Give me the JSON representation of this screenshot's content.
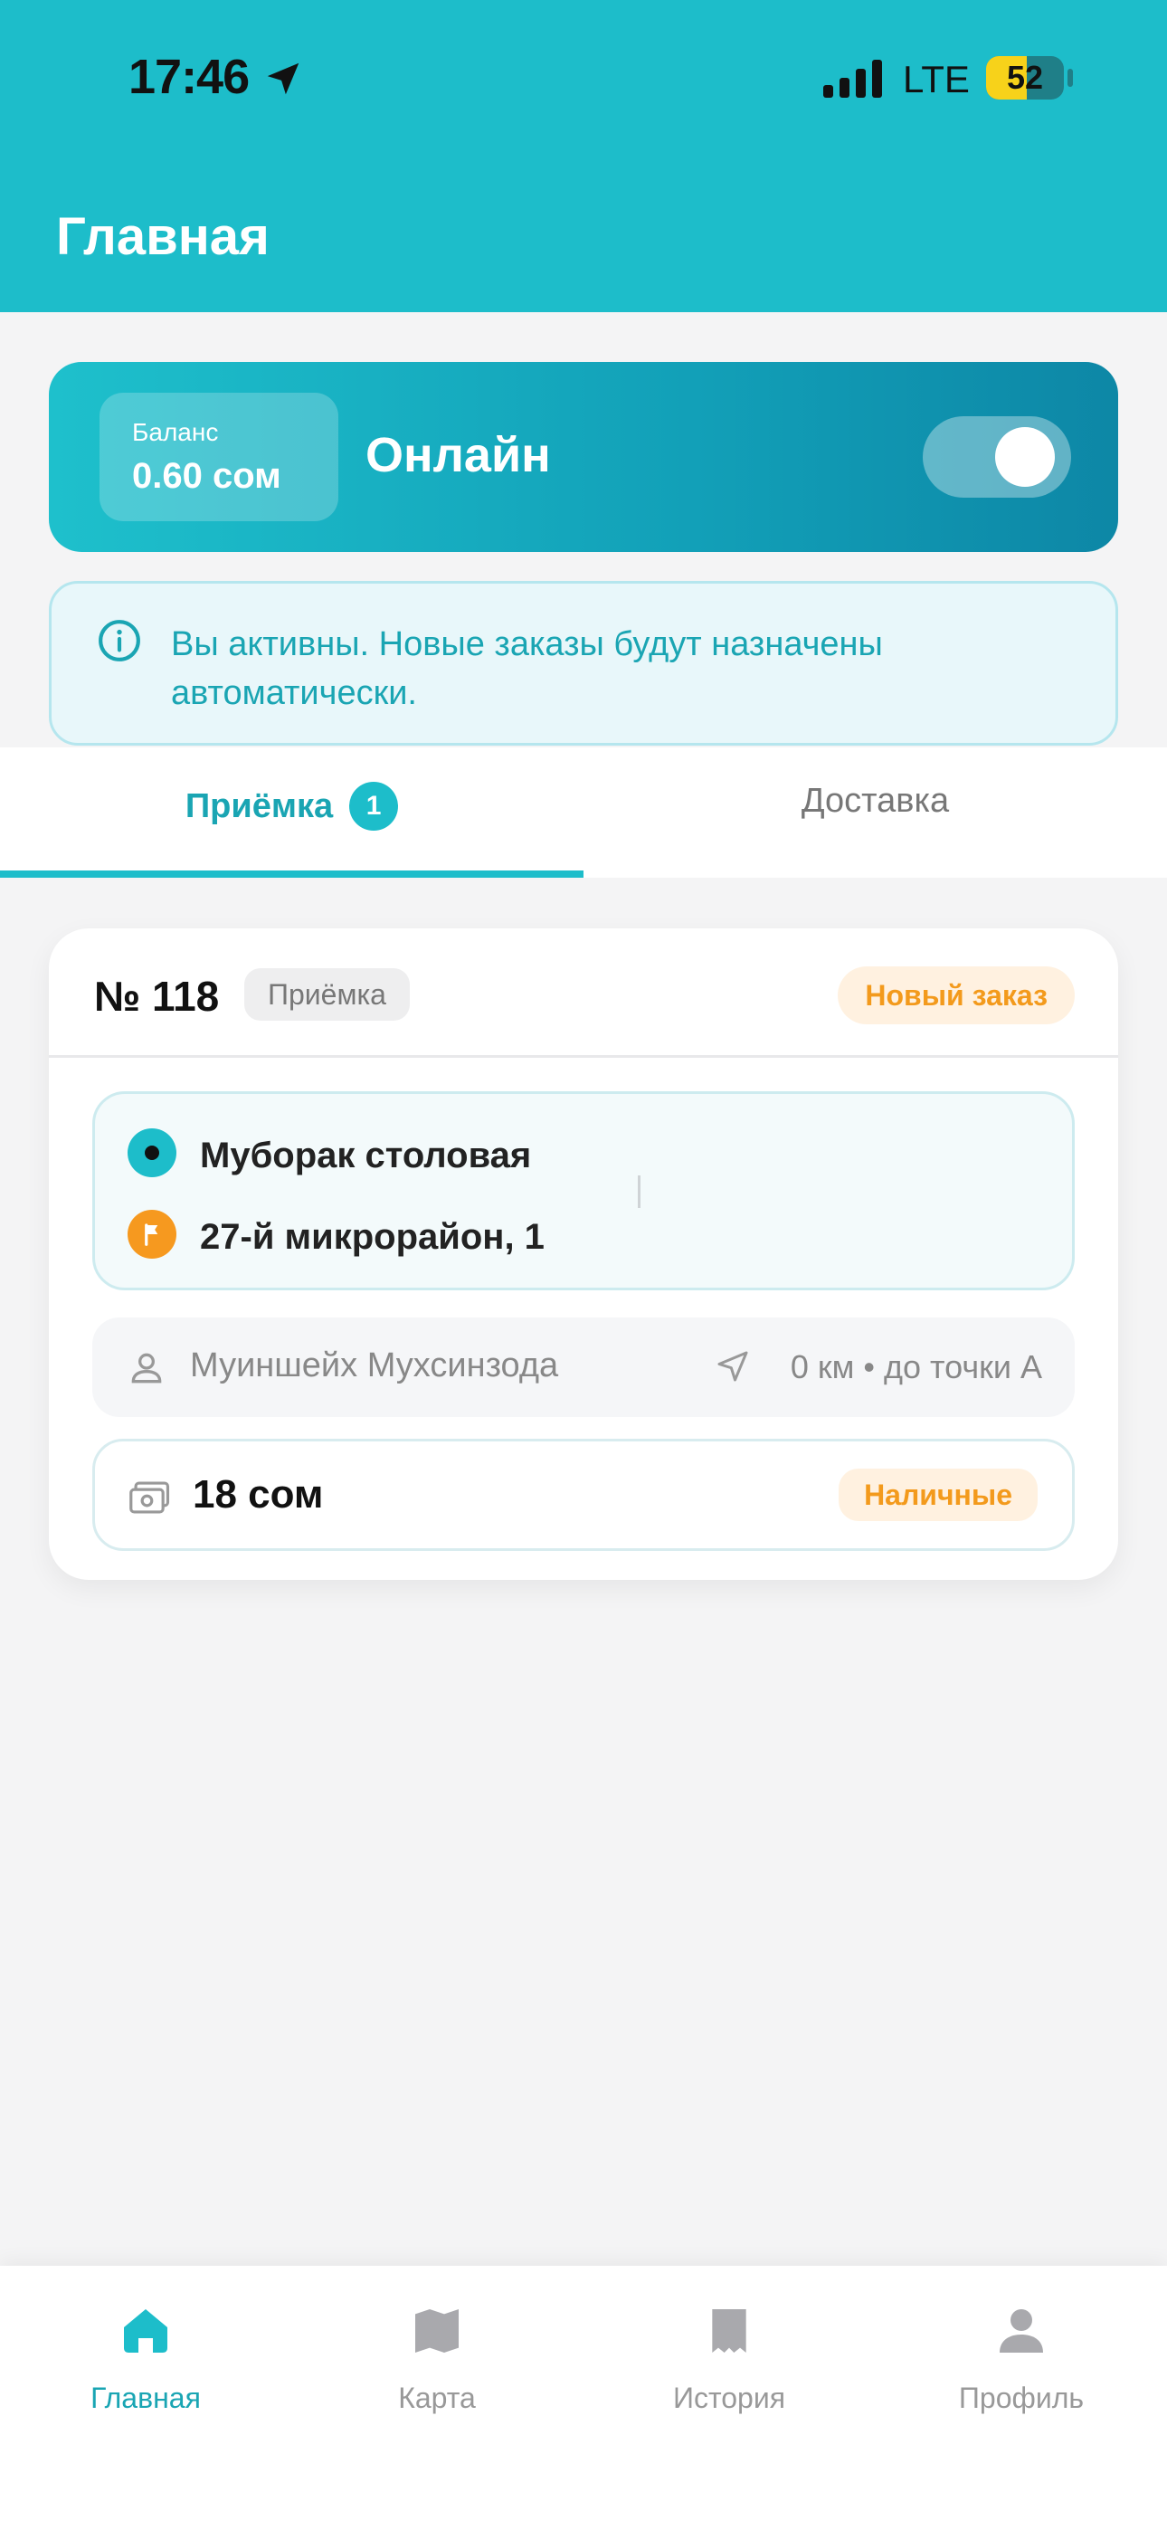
{
  "status_bar": {
    "time": "17:46",
    "network": "LTE",
    "battery": "52",
    "battery_level": 0.52
  },
  "header": {
    "title": "Главная"
  },
  "balance": {
    "label": "Баланс",
    "value": "0.60 сом",
    "status": "Онлайн",
    "online": true
  },
  "info": {
    "text": "Вы активны. Новые заказы будут назначены автоматически."
  },
  "tabs": [
    {
      "label": "Приёмка",
      "badge": "1",
      "active": true
    },
    {
      "label": "Доставка",
      "active": false
    }
  ],
  "order": {
    "number": "№ 118",
    "type": "Приёмка",
    "status": "Новый заказ",
    "point_a": "Муборак столовая",
    "point_b": "27-й микрорайон, 1",
    "customer": "Муиншейх Мухсинзода",
    "distance": "0 км • до точки А",
    "price": "18 сом",
    "payment": "Наличные"
  },
  "bottom_nav": [
    {
      "label": "Главная",
      "icon": "home-icon",
      "active": true
    },
    {
      "label": "Карта",
      "icon": "map-icon",
      "active": false
    },
    {
      "label": "История",
      "icon": "receipt-icon",
      "active": false
    },
    {
      "label": "Профиль",
      "icon": "profile-icon",
      "active": false
    }
  ],
  "colors": {
    "accent": "#1dbdca",
    "accent_text": "#1aa5b3",
    "orange": "#f39a1c"
  }
}
